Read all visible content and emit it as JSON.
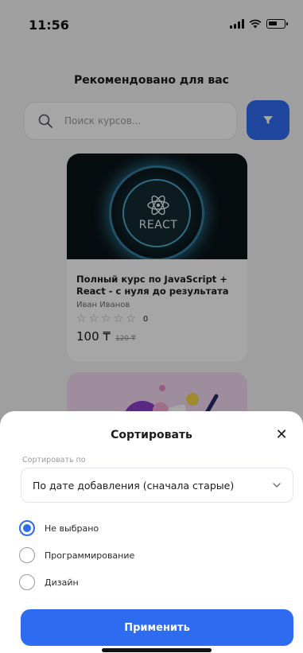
{
  "status_bar": {
    "time": "11:56",
    "icons": [
      "signal-icon",
      "wifi-icon",
      "battery-icon"
    ]
  },
  "page": {
    "title": "Рекомендовано для вас"
  },
  "search": {
    "placeholder": "Поиск курсов...",
    "icon": "search-icon"
  },
  "filter": {
    "icon": "filter-icon",
    "color": "#2d6cf0"
  },
  "course_card": {
    "thumbnail_text": "REACT",
    "title": "Полный курс по JavaScript + React - с нуля до результата",
    "author": "Иван Иванов",
    "rating_stars": 5,
    "rating_count": "0",
    "price": "100 ₸",
    "old_price": "120 ₸"
  },
  "sort_sheet": {
    "title": "Сортировать",
    "close_icon": "close-icon",
    "sort_label": "Сортировать по",
    "sort_value": "По дате добавления (сначала старые)",
    "options": [
      {
        "label": "Не выбрано",
        "checked": true
      },
      {
        "label": "Программирование",
        "checked": false
      },
      {
        "label": "Дизайн",
        "checked": false
      }
    ],
    "apply_label": "Применить"
  },
  "colors": {
    "accent": "#2d6cf0",
    "background": "#f4f4f6",
    "overlay": "rgba(0,0,0,0.35)"
  }
}
